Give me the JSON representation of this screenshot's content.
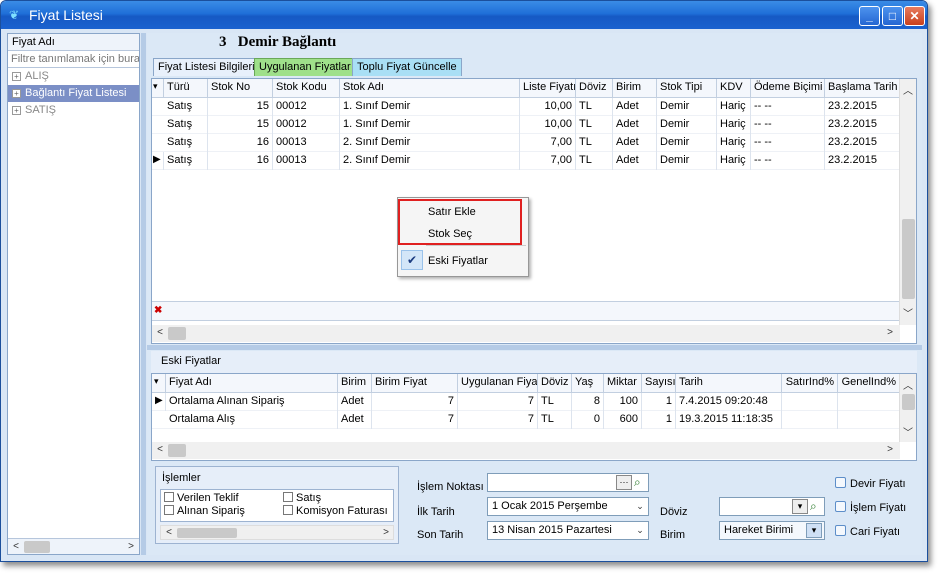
{
  "window": {
    "title": "Fiyat Listesi",
    "minimize": "_",
    "maximize": "□",
    "close": "✕"
  },
  "left_panel": {
    "header": "Fiyat Adı",
    "filter_placeholder": "Filtre tanımlamak için buraya",
    "nodes": [
      {
        "label": "ALIŞ",
        "expander": "+"
      },
      {
        "label": "Bağlantı Fiyat Listesi",
        "expander": "+"
      },
      {
        "label": "SATIŞ",
        "expander": "+"
      }
    ]
  },
  "document": {
    "number": "3",
    "title": "Demir Bağlantı"
  },
  "tabs": [
    {
      "label": "Fiyat Listesi Bilgileri"
    },
    {
      "label": "Uygulanan Fiyatlar"
    },
    {
      "label": "Toplu Fiyat Güncelle"
    }
  ],
  "main_grid": {
    "columns": [
      "Türü",
      "Stok No",
      "Stok Kodu",
      "Stok Adı",
      "Liste Fiyatı",
      "Döviz",
      "Birim",
      "Stok Tipi",
      "KDV",
      "Ödeme Biçimi",
      "Başlama Tarih"
    ],
    "rows": [
      {
        "turu": "Satış",
        "stok_no": "15",
        "stok_kodu": "00012",
        "stok_adi": "1. Sınıf Demir",
        "liste_fiyati": "10,00",
        "doviz": "TL",
        "birim": "Adet",
        "stok_tipi": "Demir",
        "kdv": "Hariç",
        "odeme": "-- --",
        "baslama": "23.2.2015"
      },
      {
        "turu": "Satış",
        "stok_no": "15",
        "stok_kodu": "00012",
        "stok_adi": "1. Sınıf Demir",
        "liste_fiyati": "10,00",
        "doviz": "TL",
        "birim": "Adet",
        "stok_tipi": "Demir",
        "kdv": "Hariç",
        "odeme": "-- --",
        "baslama": "23.2.2015"
      },
      {
        "turu": "Satış",
        "stok_no": "16",
        "stok_kodu": "00013",
        "stok_adi": "2. Sınıf Demir",
        "liste_fiyati": "7,00",
        "doviz": "TL",
        "birim": "Adet",
        "stok_tipi": "Demir",
        "kdv": "Hariç",
        "odeme": "-- --",
        "baslama": "23.2.2015"
      },
      {
        "turu": "Satış",
        "stok_no": "16",
        "stok_kodu": "00013",
        "stok_adi": "2. Sınıf Demir",
        "liste_fiyati": "7,00",
        "doviz": "TL",
        "birim": "Adet",
        "stok_tipi": "Demir",
        "kdv": "Hariç",
        "odeme": "-- --",
        "baslama": "23.2.2015"
      }
    ]
  },
  "context_menu": {
    "items": [
      {
        "label": "Satır Ekle"
      },
      {
        "label": "Stok Seç"
      },
      {
        "label": "Eski Fiyatlar",
        "checked": true
      }
    ],
    "check_mark": "✔"
  },
  "eski_fiyatlar": {
    "title": "Eski Fiyatlar",
    "columns": [
      "Fiyat Adı",
      "Birim",
      "Birim Fiyat",
      "Uygulanan Fiyat",
      "Döviz",
      "Yaş",
      "Miktar",
      "Sayısı",
      "Tarih",
      "SatırInd%",
      "GenelInd%"
    ],
    "rows": [
      {
        "fiyat_adi": "Ortalama Alınan Sipariş",
        "birim": "Adet",
        "birim_fiyat": "7",
        "uygulanan": "7",
        "doviz": "TL",
        "yas": "8",
        "miktar": "100",
        "sayisi": "1",
        "tarih": "7.4.2015 09:20:48"
      },
      {
        "fiyat_adi": "Ortalama Alış",
        "birim": "Adet",
        "birim_fiyat": "7",
        "uygulanan": "7",
        "doviz": "TL",
        "yas": "0",
        "miktar": "600",
        "sayisi": "1",
        "tarih": "19.3.2015 11:18:35"
      }
    ]
  },
  "islemler": {
    "title": "İşlemler",
    "options": [
      "Verilen Teklif",
      "Satış",
      "Alınan Sipariş",
      "Komisyon Faturası"
    ]
  },
  "filters": {
    "islem_noktasi_label": "İşlem Noktası",
    "ilk_tarih_label": "İlk Tarih",
    "ilk_tarih_value": "1  Ocak  2015 Perşembe",
    "son_tarih_label": "Son Tarih",
    "son_tarih_value": "13  Nisan  2015 Pazartesi",
    "doviz_label": "Döviz",
    "birim_label": "Birim",
    "birim_value": "Hareket Birimi",
    "devir_label": "Devir Fiyatı",
    "islem_fiyati_label": "İşlem Fiyatı",
    "cari_label": "Cari Fiyatı"
  }
}
